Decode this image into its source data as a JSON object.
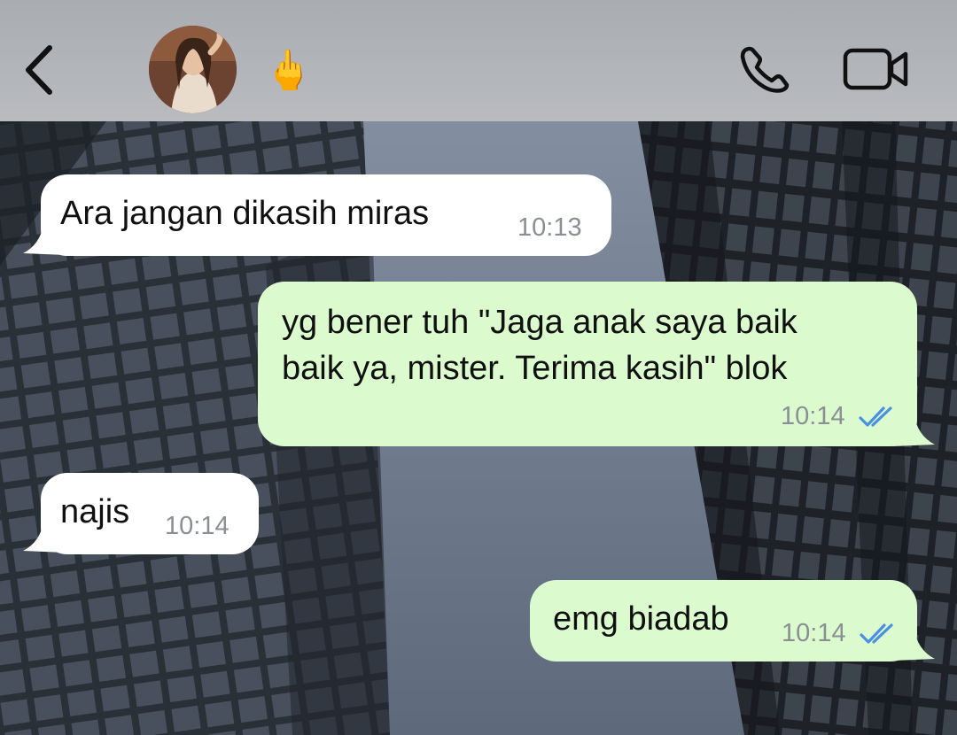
{
  "header": {
    "contact_emoji": "🖕",
    "icons": {
      "back": "chevron-left-icon",
      "call": "phone-icon",
      "video": "video-camera-icon"
    }
  },
  "colors": {
    "incoming_bubble": "#ffffff",
    "outgoing_bubble": "#dbfbcf",
    "read_ticks": "#4a90e2",
    "timestamp": "#8a8f93"
  },
  "messages": [
    {
      "direction": "incoming",
      "text": "Ara jangan dikasih miras",
      "time": "10:13"
    },
    {
      "direction": "outgoing",
      "text": "yg bener tuh \"Jaga anak saya baik\nbaik ya, mister. Terima kasih\" blok",
      "time": "10:14",
      "status": "read"
    },
    {
      "direction": "incoming",
      "text": "najis",
      "time": "10:14"
    },
    {
      "direction": "outgoing",
      "text": "emg biadab",
      "time": "10:14",
      "status": "read"
    }
  ]
}
